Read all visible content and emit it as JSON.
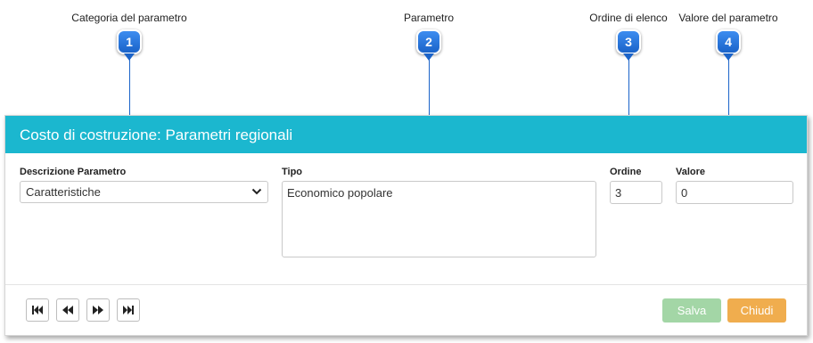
{
  "callouts": [
    {
      "number": "1",
      "label": "Categoria del parametro"
    },
    {
      "number": "2",
      "label": "Parametro"
    },
    {
      "number": "3",
      "label": "Ordine di elenco"
    },
    {
      "number": "4",
      "label": "Valore del parametro"
    }
  ],
  "dialog": {
    "title": "Costo di costruzione: Parametri regionali",
    "header_color": "#1bb7cf"
  },
  "form": {
    "descrizione_label": "Descrizione Parametro",
    "descrizione_value": "Caratteristiche",
    "tipo_label": "Tipo",
    "tipo_value": "Economico popolare",
    "ordine_label": "Ordine",
    "ordine_value": "3",
    "valore_label": "Valore",
    "valore_value": "0"
  },
  "navigation": [
    {
      "name": "first-record-icon"
    },
    {
      "name": "previous-record-icon"
    },
    {
      "name": "next-record-icon"
    },
    {
      "name": "last-record-icon"
    }
  ],
  "buttons": {
    "save_label": "Salva",
    "save_color": "#a3d6a6",
    "close_label": "Chiudi",
    "close_color": "#f0ad4e"
  }
}
